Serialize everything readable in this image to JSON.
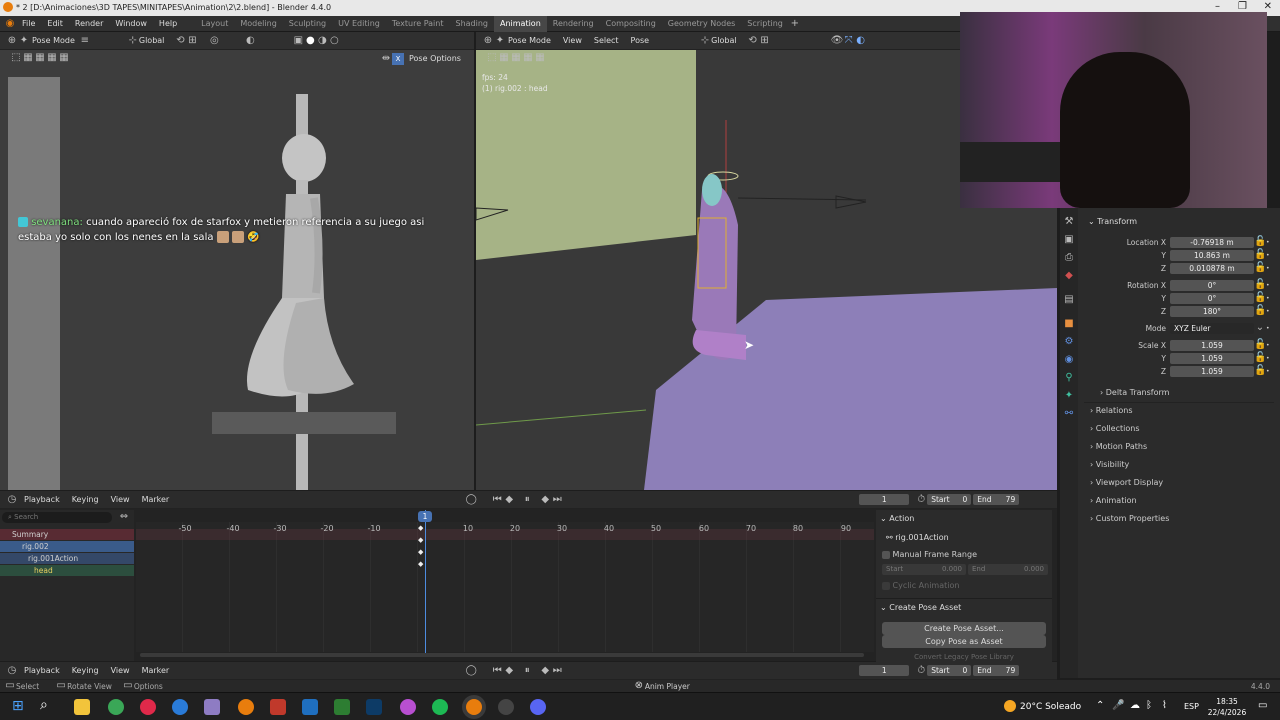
{
  "title": "* 2 [D:\\Animaciones\\3D TAPES\\MINITAPES\\Animation\\2\\2.blend] - Blender 4.4.0",
  "menu": [
    "File",
    "Edit",
    "Render",
    "Window",
    "Help"
  ],
  "workspaces": [
    "Layout",
    "Modeling",
    "Sculpting",
    "UV Editing",
    "Texture Paint",
    "Shading",
    "Animation",
    "Rendering",
    "Compositing",
    "Geometry Nodes",
    "Scripting"
  ],
  "active_workspace": "Animation",
  "left_view": {
    "mode": "Pose Mode",
    "orientation": "Global",
    "pose_options": "Pose Options"
  },
  "right_view": {
    "mode": "Pose Mode",
    "menu": [
      "View",
      "Select",
      "Pose"
    ],
    "orientation": "Global",
    "fps": "fps: 24",
    "active": "(1) rig.002 : head"
  },
  "chat": {
    "user": "sevanana:",
    "message": "cuando apareció fox de starfox y metieron referencia a su juego asi estaba yo solo con los nenes en la sala"
  },
  "properties": {
    "transform": "Transform",
    "location": {
      "label": "Location X",
      "x": "-0.76918 m",
      "y": "10.863 m",
      "z": "0.010878 m"
    },
    "rotation": {
      "label": "Rotation X",
      "x": "0°",
      "y": "0°",
      "z": "180°"
    },
    "mode": {
      "label": "Mode",
      "value": "XYZ Euler"
    },
    "scale": {
      "label": "Scale X",
      "x": "1.059",
      "y": "1.059",
      "z": "1.059"
    },
    "axis_y": "Y",
    "axis_z": "Z",
    "delta": "Delta Transform",
    "sections": [
      "Relations",
      "Collections",
      "Motion Paths",
      "Visibility",
      "Viewport Display",
      "Animation",
      "Custom Properties"
    ]
  },
  "timeline": {
    "menu": [
      "Playback",
      "Keying",
      "View",
      "Marker"
    ],
    "frame": "1",
    "start_label": "Start",
    "start": "0",
    "end_label": "End",
    "end": "79",
    "search_placeholder": "Search",
    "channels": [
      "Summary",
      "rig.002",
      "rig.001Action",
      "head"
    ],
    "ticks": [
      "-50",
      "-40",
      "-30",
      "-20",
      "-10",
      "1",
      "10",
      "20",
      "30",
      "40",
      "50",
      "60",
      "70",
      "80",
      "90"
    ],
    "current_frame": "1"
  },
  "action_panel": {
    "title": "Action",
    "action": "rig.001Action",
    "manual": "Manual Frame Range",
    "start_label": "Start",
    "start": "0.000",
    "end_label": "End",
    "end": "0.000",
    "cyclic": "Cyclic Animation",
    "pose_asset": "Create Pose Asset",
    "create_btn": "Create Pose Asset...",
    "copy_btn": "Copy Pose as Asset",
    "convert": "Convert Legacy Pose Library"
  },
  "status": {
    "select": "Select",
    "rotate": "Rotate View",
    "options": "Options",
    "anim": "Anim Player",
    "version": "4.4.0"
  },
  "taskbar": {
    "weather": "20°C Soleado",
    "lang": "ESP",
    "time": "18:35",
    "date": "22/4/2026"
  }
}
